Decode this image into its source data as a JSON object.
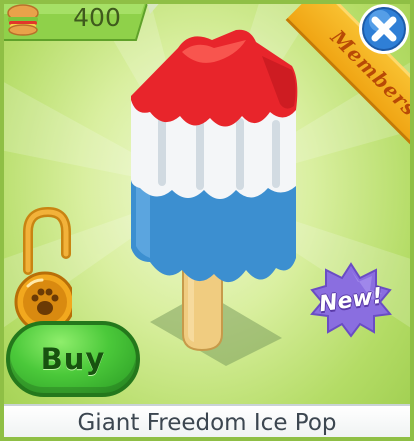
{
  "currency": {
    "amount": "400",
    "icon": "sandwich-icon"
  },
  "members_badge": {
    "label": "Members"
  },
  "close": {
    "icon": "close-x-icon"
  },
  "new_badge": {
    "label": "New!"
  },
  "buy_button": {
    "label": "Buy"
  },
  "item": {
    "name": "Giant Freedom Ice Pop",
    "lock_icon": "paw-lock-icon"
  },
  "colors": {
    "red": "#e8252b",
    "white": "#f4f6f8",
    "blue": "#3c8fd0",
    "stick": "#f0cc80",
    "buy_green": "#4bc93a",
    "ribbon_orange": "#f0a514",
    "new_purple": "#8a6ee0"
  }
}
